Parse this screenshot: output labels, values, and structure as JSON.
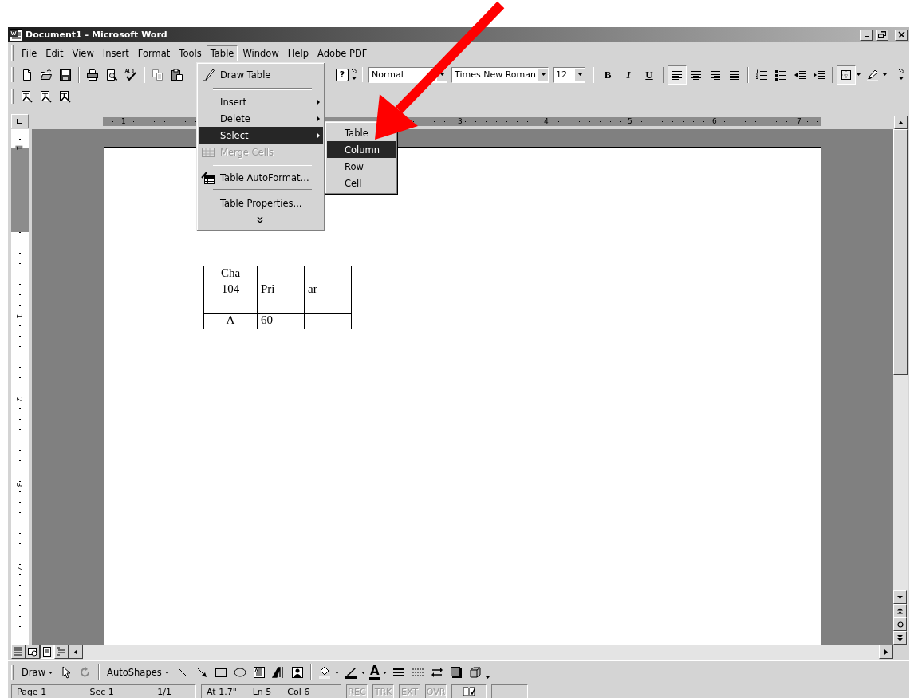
{
  "window": {
    "title": "Document1 - Microsoft Word"
  },
  "menu_bar": [
    {
      "label": "File",
      "selected": false
    },
    {
      "label": "Edit",
      "selected": false
    },
    {
      "label": "View",
      "selected": false
    },
    {
      "label": "Insert",
      "selected": false
    },
    {
      "label": "Format",
      "selected": false
    },
    {
      "label": "Tools",
      "selected": false
    },
    {
      "label": "Table",
      "selected": true
    },
    {
      "label": "Window",
      "selected": false
    },
    {
      "label": "Help",
      "selected": false
    },
    {
      "label": "Adobe PDF",
      "selected": false
    }
  ],
  "formatting_toolbar": {
    "help_button": "?",
    "style": "Normal",
    "font": "Times New Roman",
    "size": "12",
    "text_style_buttons": [
      {
        "kind": "bold",
        "label": "B"
      },
      {
        "kind": "italic",
        "label": "I"
      },
      {
        "kind": "underline",
        "label": "U"
      }
    ],
    "alignment_buttons": [
      {
        "selected": true
      },
      {
        "selected": false
      },
      {
        "selected": false
      },
      {
        "selected": false
      }
    ]
  },
  "table_menu": {
    "items": [
      {
        "kind": "command",
        "label": "Draw Table",
        "selected": false,
        "disabled": false
      },
      {
        "kind": "separator"
      },
      {
        "kind": "submenu",
        "label": "Insert",
        "selected": false,
        "disabled": false
      },
      {
        "kind": "submenu",
        "label": "Delete",
        "selected": false,
        "disabled": false
      },
      {
        "kind": "submenu",
        "label": "Select",
        "selected": true,
        "disabled": false
      },
      {
        "kind": "command",
        "label": "Merge Cells",
        "selected": false,
        "disabled": true
      },
      {
        "kind": "separator"
      },
      {
        "kind": "command",
        "label": "Table AutoFormat...",
        "selected": false,
        "disabled": false
      },
      {
        "kind": "separator"
      },
      {
        "kind": "command",
        "label": "Table Properties...",
        "selected": false,
        "disabled": false
      },
      {
        "kind": "expand"
      }
    ]
  },
  "select_submenu": {
    "items": [
      {
        "label": "Table",
        "selected": false
      },
      {
        "label": "Column",
        "selected": true
      },
      {
        "label": "Row",
        "selected": false
      },
      {
        "label": "Cell",
        "selected": false
      }
    ]
  },
  "rulers": {
    "horizontal": [
      "1",
      "3",
      "4",
      "5",
      "6",
      "7"
    ],
    "vertical": [
      "1",
      "1",
      "2",
      "3",
      "4"
    ]
  },
  "document": {
    "table": {
      "rows": [
        [
          "Cha",
          null,
          null
        ],
        [
          "104",
          "Pri",
          "ar"
        ],
        [
          "A",
          "60",
          null
        ]
      ]
    }
  },
  "drawing_toolbar": {
    "draw_menu": {
      "label": "Draw"
    },
    "autoshapes_menu": {
      "label": "AutoShapes"
    },
    "font_color": "A"
  },
  "status_bar": {
    "page": "Page 1",
    "section": "Sec 1",
    "pages": "1/1",
    "at": "At 1.7\"",
    "line": "Ln 5",
    "column": "Col 6",
    "modes": [
      {
        "label": "REC",
        "on": false
      },
      {
        "label": "TRK",
        "on": false
      },
      {
        "label": "EXT",
        "on": false
      },
      {
        "label": "OVR",
        "on": false
      }
    ]
  }
}
